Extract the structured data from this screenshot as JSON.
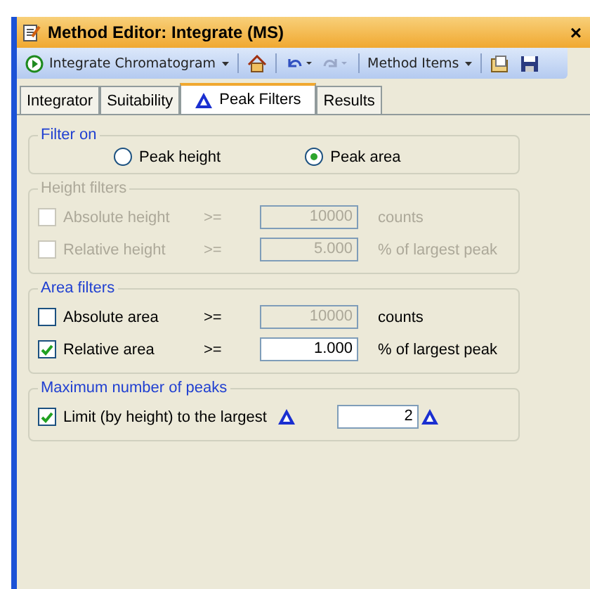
{
  "window": {
    "title": "Method Editor: Integrate (MS)",
    "close": "×"
  },
  "toolbar": {
    "run_button": "Integrate Chromatogram",
    "method_items": "Method Items"
  },
  "tabs": [
    {
      "label": "Integrator",
      "selected": false,
      "icon": false
    },
    {
      "label": "Suitability",
      "selected": false,
      "icon": false
    },
    {
      "label": "Peak Filters",
      "selected": true,
      "icon": true
    },
    {
      "label": "Results",
      "selected": false,
      "icon": false
    }
  ],
  "filter_on": {
    "title": "Filter on",
    "options": [
      {
        "label": "Peak height",
        "selected": false
      },
      {
        "label": "Peak area",
        "selected": true
      }
    ]
  },
  "groups": [
    {
      "title": "Height filters",
      "disabled": true,
      "rows": [
        {
          "label": "Absolute height",
          "checked": false,
          "operator": ">=",
          "value": "10000",
          "field_disabled": true,
          "unit": "counts"
        },
        {
          "label": "Relative height",
          "checked": false,
          "operator": ">=",
          "value": "5.000",
          "field_disabled": true,
          "unit": "% of largest peak"
        }
      ]
    },
    {
      "title": "Area filters",
      "disabled": false,
      "rows": [
        {
          "label": "Absolute area",
          "checked": false,
          "operator": ">=",
          "value": "10000",
          "field_disabled": true,
          "unit": "counts"
        },
        {
          "label": "Relative area",
          "checked": true,
          "operator": ">=",
          "value": "1.000",
          "field_disabled": false,
          "unit": "% of largest peak"
        }
      ]
    }
  ],
  "max_peaks": {
    "title": "Maximum number of peaks",
    "label": "Limit (by height) to the largest",
    "checked": true,
    "value": "2"
  }
}
